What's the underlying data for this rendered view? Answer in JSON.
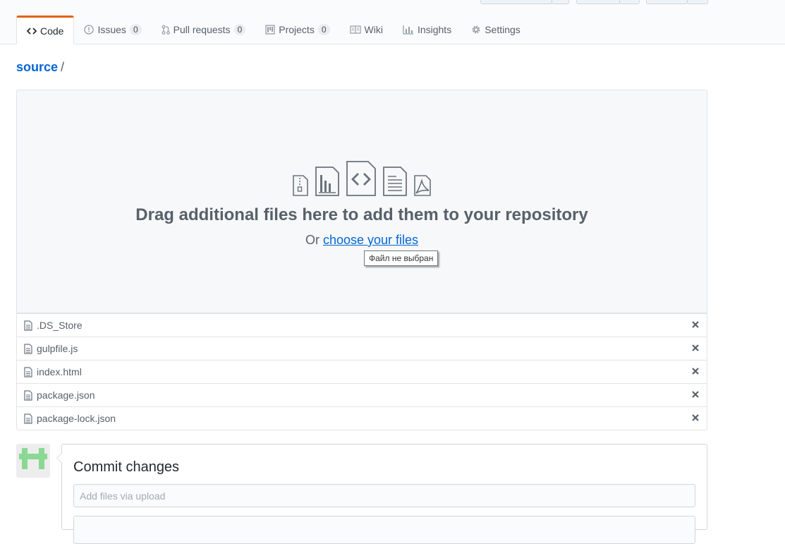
{
  "nav": {
    "tabs": [
      {
        "label": "Code",
        "icon": "code-icon"
      },
      {
        "label": "Issues",
        "count": "0",
        "icon": "issue-opened-icon"
      },
      {
        "label": "Pull requests",
        "count": "0",
        "icon": "git-pull-request-icon"
      },
      {
        "label": "Projects",
        "count": "0",
        "icon": "project-icon"
      },
      {
        "label": "Wiki",
        "icon": "book-icon"
      },
      {
        "label": "Insights",
        "icon": "graph-icon"
      },
      {
        "label": "Settings",
        "icon": "gear-icon"
      }
    ]
  },
  "breadcrumb": {
    "repo": "source",
    "separator": "/"
  },
  "upload": {
    "drop_text": "Drag additional files here to add them to your repository",
    "or_text": "Or",
    "choose_link": "choose your files",
    "tooltip": "Файл не выбран"
  },
  "files": [
    {
      "name": ".DS_Store"
    },
    {
      "name": "gulpfile.js"
    },
    {
      "name": "index.html"
    },
    {
      "name": "package.json"
    },
    {
      "name": "package-lock.json"
    }
  ],
  "commit": {
    "title": "Commit changes",
    "summary_placeholder": "Add files via upload",
    "summary_value": ""
  },
  "colors": {
    "accent": "#e36209",
    "link": "#0366d6",
    "avatar": "#8ad894"
  }
}
